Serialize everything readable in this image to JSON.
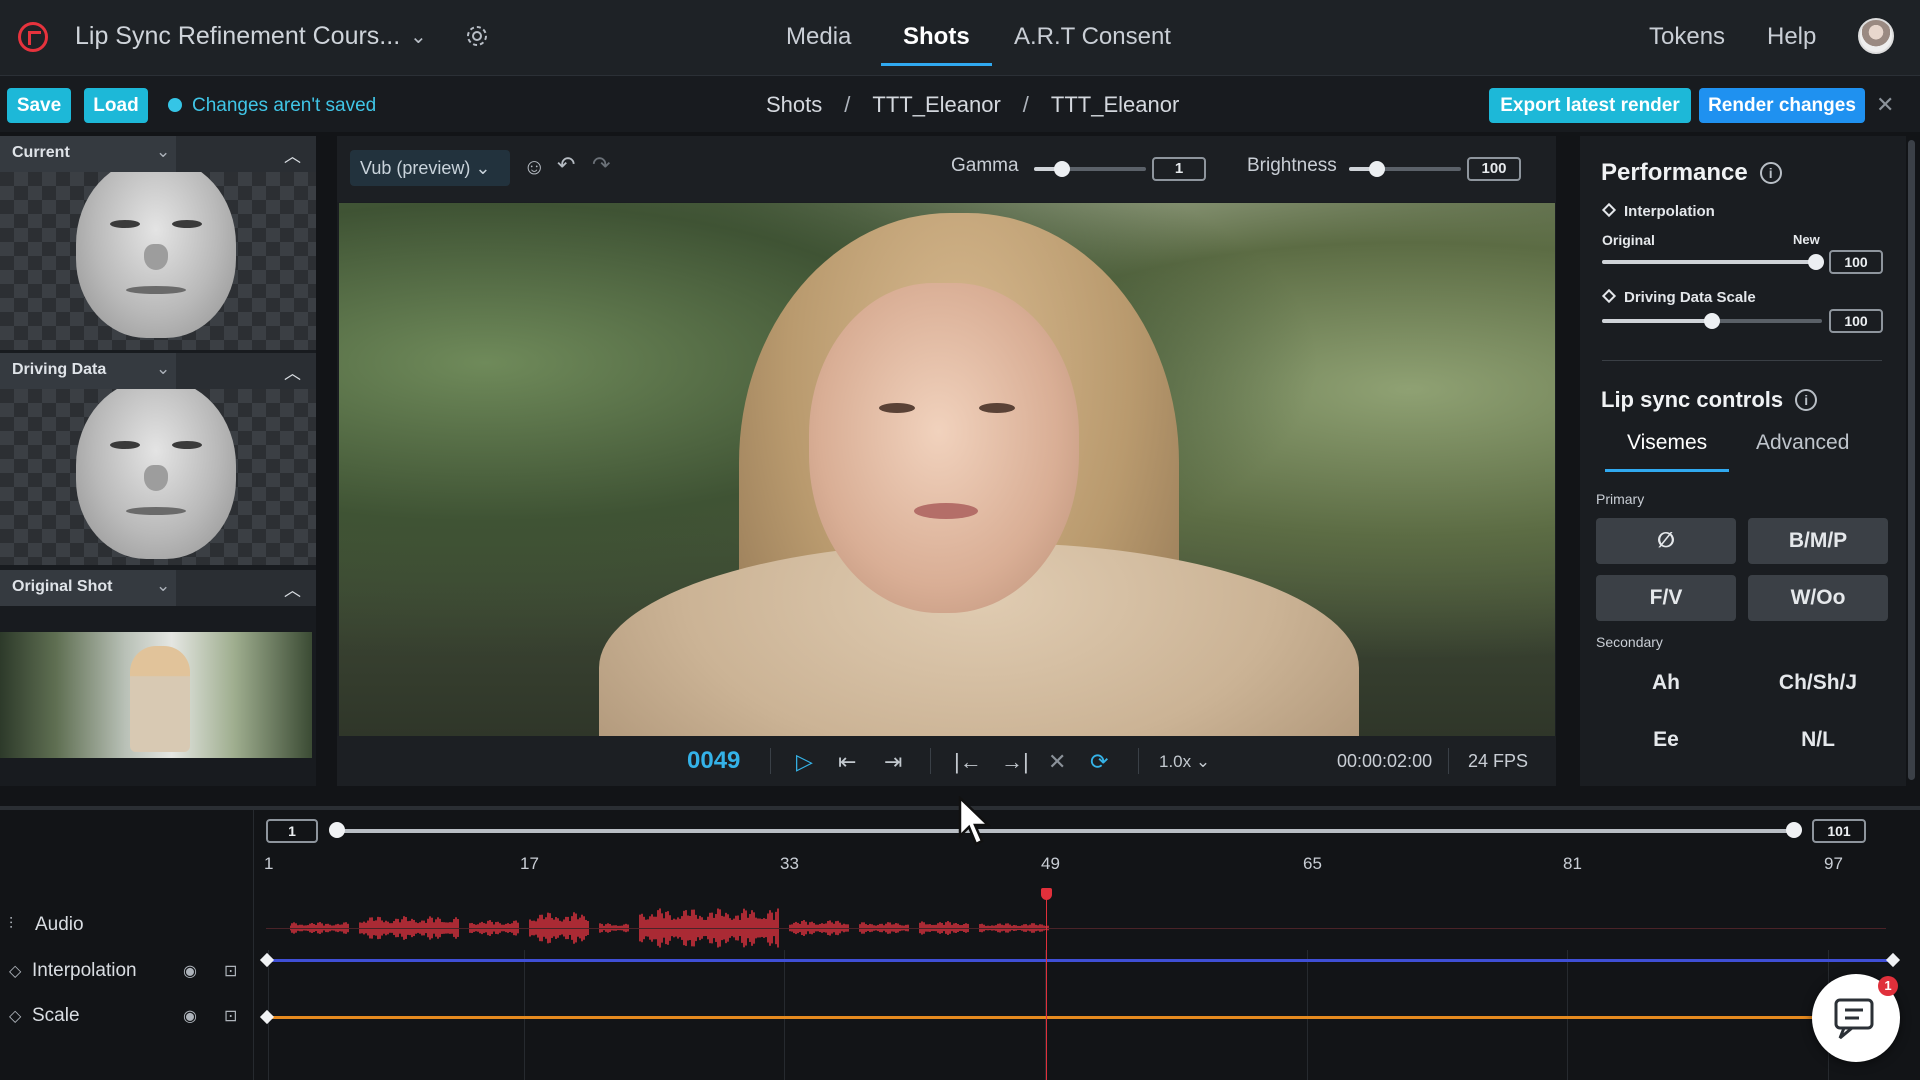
{
  "header": {
    "project_title": "Lip Sync Refinement Cours...",
    "nav": [
      "Media",
      "Shots",
      "A.R.T Consent"
    ],
    "active_nav": "Shots",
    "right_links": [
      "Tokens",
      "Help"
    ]
  },
  "toolbar": {
    "save_label": "Save",
    "load_label": "Load",
    "unsaved_text": "Changes aren't saved",
    "breadcrumb": [
      "Shots",
      "TTT_Eleanor",
      "TTT_Eleanor"
    ],
    "export_label": "Export latest render",
    "render_label": "Render changes"
  },
  "left_panel": {
    "sections": [
      "Current",
      "Driving Data",
      "Original Shot"
    ]
  },
  "viewer": {
    "mode_dropdown": "Vub (preview)",
    "gamma_label": "Gamma",
    "gamma_value": "1",
    "gamma_level": 0.25,
    "brightness_label": "Brightness",
    "brightness_value": "100",
    "brightness_level": 0.25,
    "frame": "0049",
    "speed": "1.0x",
    "timecode": "00:00:02:00",
    "fps": "24 FPS"
  },
  "performance": {
    "title": "Performance",
    "interpolation_label": "Interpolation",
    "original_label": "Original",
    "new_label": "New",
    "interpolation_value": "100",
    "interpolation_level": 1.0,
    "driving_scale_label": "Driving Data Scale",
    "driving_scale_value": "100",
    "driving_scale_level": 0.5
  },
  "lipsync": {
    "title": "Lip sync controls",
    "tabs": [
      "Visemes",
      "Advanced"
    ],
    "active_tab": "Visemes",
    "primary_label": "Primary",
    "primary": [
      "∅",
      "B/M/P",
      "F/V",
      "W/Oo"
    ],
    "secondary_label": "Secondary",
    "secondary": [
      "Ah",
      "Ch/Sh/J",
      "Ee",
      "N/L"
    ]
  },
  "timeline": {
    "range_start": "1",
    "range_end": "101",
    "ticks": [
      "1",
      "17",
      "33",
      "49",
      "65",
      "81",
      "97"
    ],
    "tracks": [
      "Audio",
      "Interpolation",
      "Scale"
    ],
    "playhead_frame": 49,
    "colors": {
      "audio": "#d0303b",
      "interpolation": "#3f4fd6",
      "scale": "#e68a1f"
    }
  },
  "chat": {
    "badge": "1"
  }
}
